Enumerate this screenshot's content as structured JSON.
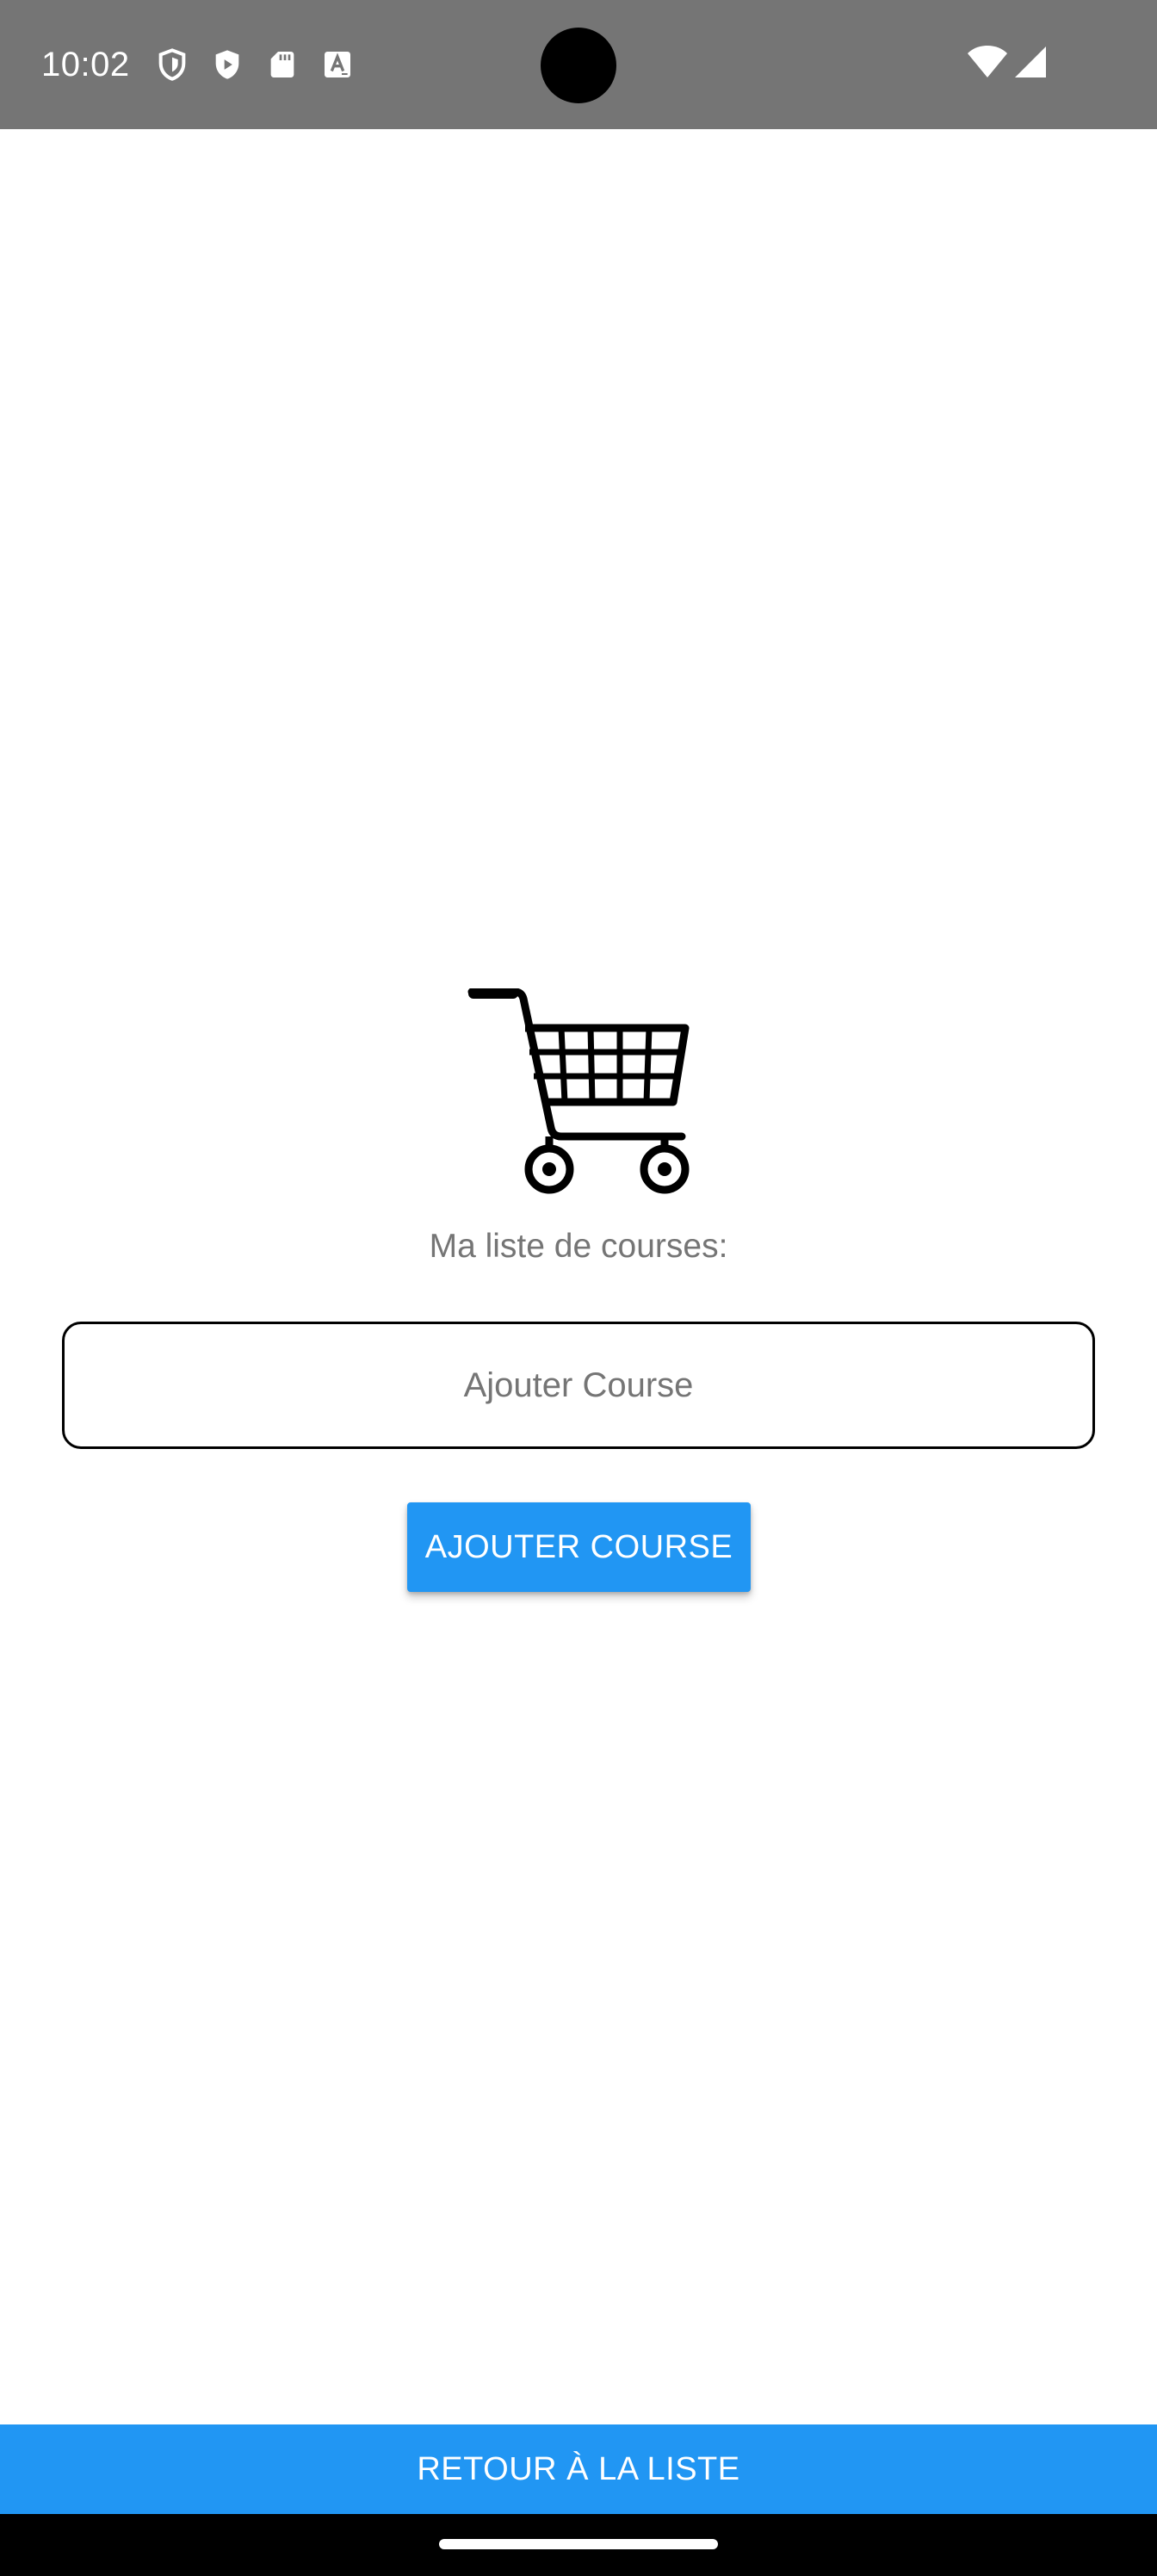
{
  "status_bar": {
    "time": "10:02",
    "left_icons": [
      "shield-icon",
      "play-protect-icon",
      "sd-card-icon",
      "font-badge-icon"
    ],
    "right_icons": [
      "wifi-icon",
      "cell-signal-icon"
    ]
  },
  "main": {
    "cart_icon": "shopping-cart-icon",
    "title": "Ma liste de courses:",
    "input": {
      "placeholder": "Ajouter Course",
      "value": ""
    },
    "add_button_label": "AJOUTER COURSE"
  },
  "footer": {
    "back_button_label": "RETOUR À LA LISTE"
  },
  "colors": {
    "accent": "#2196f3",
    "status_bar": "#757575",
    "text_muted": "#757575"
  }
}
